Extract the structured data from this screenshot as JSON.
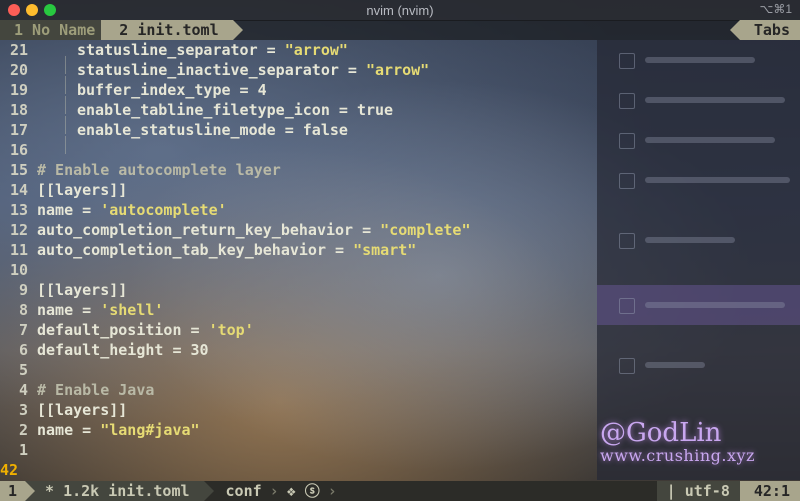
{
  "window": {
    "title": "nvim (nvim)",
    "right_shortcut": "⌥⌘1"
  },
  "tabline": {
    "tabs": [
      {
        "label": "1 No Name",
        "active": false
      },
      {
        "label": "2 init.toml",
        "active": true
      }
    ],
    "tabs_label": "Tabs"
  },
  "editor": {
    "lines": [
      {
        "num": "21",
        "indent": true,
        "segments": [
          {
            "t": "statusline_separator = ",
            "c": "key"
          },
          {
            "t": "\"arrow\"",
            "c": "str"
          }
        ]
      },
      {
        "num": "20",
        "indent": true,
        "segments": [
          {
            "t": "statusline_inactive_separator = ",
            "c": "key"
          },
          {
            "t": "\"arrow\"",
            "c": "str"
          }
        ]
      },
      {
        "num": "19",
        "indent": true,
        "segments": [
          {
            "t": "buffer_index_type = 4",
            "c": "key"
          }
        ]
      },
      {
        "num": "18",
        "indent": true,
        "segments": [
          {
            "t": "enable_tabline_filetype_icon = true",
            "c": "key"
          }
        ]
      },
      {
        "num": "17",
        "indent": true,
        "segments": [
          {
            "t": "enable_statusline_mode = false",
            "c": "key"
          }
        ]
      },
      {
        "num": "16",
        "indent": false,
        "segments": []
      },
      {
        "num": "15",
        "indent": false,
        "segments": [
          {
            "t": "# Enable autocomplete layer",
            "c": "comment"
          }
        ]
      },
      {
        "num": "14",
        "indent": false,
        "segments": [
          {
            "t": "[[layers]]",
            "c": "section"
          }
        ]
      },
      {
        "num": "13",
        "indent": false,
        "segments": [
          {
            "t": "name = ",
            "c": "key"
          },
          {
            "t": "'autocomplete'",
            "c": "str"
          }
        ]
      },
      {
        "num": "12",
        "indent": false,
        "segments": [
          {
            "t": "auto_completion_return_key_behavior = ",
            "c": "key"
          },
          {
            "t": "\"complete\"",
            "c": "str"
          }
        ]
      },
      {
        "num": "11",
        "indent": false,
        "segments": [
          {
            "t": "auto_completion_tab_key_behavior = ",
            "c": "key"
          },
          {
            "t": "\"smart\"",
            "c": "str"
          }
        ]
      },
      {
        "num": "10",
        "indent": false,
        "segments": []
      },
      {
        "num": "9",
        "indent": false,
        "segments": [
          {
            "t": "[[layers]]",
            "c": "section"
          }
        ]
      },
      {
        "num": "8",
        "indent": false,
        "segments": [
          {
            "t": "name = ",
            "c": "key"
          },
          {
            "t": "'shell'",
            "c": "str"
          }
        ]
      },
      {
        "num": "7",
        "indent": false,
        "segments": [
          {
            "t": "default_position = ",
            "c": "key"
          },
          {
            "t": "'top'",
            "c": "str"
          }
        ]
      },
      {
        "num": "6",
        "indent": false,
        "segments": [
          {
            "t": "default_height = 30",
            "c": "key"
          }
        ]
      },
      {
        "num": "5",
        "indent": false,
        "segments": []
      },
      {
        "num": "4",
        "indent": false,
        "segments": [
          {
            "t": "# Enable Java",
            "c": "comment"
          }
        ]
      },
      {
        "num": "3",
        "indent": false,
        "segments": [
          {
            "t": "[[layers]]",
            "c": "section"
          }
        ]
      },
      {
        "num": "2",
        "indent": false,
        "segments": [
          {
            "t": "name = ",
            "c": "key"
          },
          {
            "t": "\"lang#java\"",
            "c": "str"
          }
        ]
      },
      {
        "num": "1",
        "indent": false,
        "segments": []
      },
      {
        "num": "42",
        "indent": false,
        "current": true,
        "segments": []
      }
    ]
  },
  "watermark": {
    "name": "@GodLin",
    "site": "www.crushing.xyz"
  },
  "statusline": {
    "mode": "1",
    "file": "* 1.2k init.toml",
    "filetype": "conf",
    "icons": "❖ ⓢ",
    "os_icon": "",
    "encoding": "| utf-8",
    "position": "42:1"
  },
  "colors": {
    "string": "#e6db74",
    "current_line_number": "#f0b000",
    "accent_segment": "#a8a58c"
  }
}
